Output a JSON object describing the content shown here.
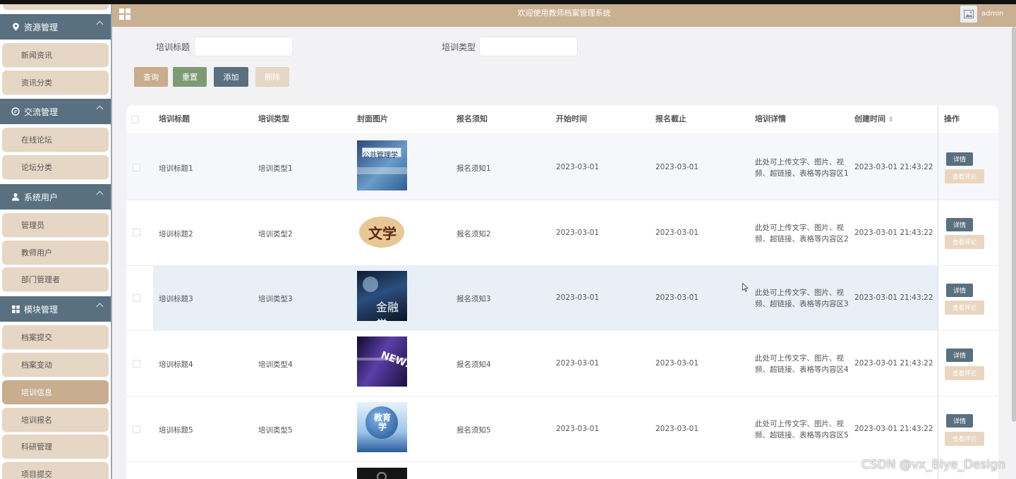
{
  "header": {
    "title": "欢迎使用教师档案管理系统",
    "username": "admin"
  },
  "sidebar": {
    "groups": [
      {
        "label": "资源管理",
        "icon": "location-pin-icon",
        "items": [
          "新闻资讯",
          "资讯分类"
        ]
      },
      {
        "label": "交流管理",
        "icon": "chat-icon",
        "items": [
          "在线论坛",
          "论坛分类"
        ]
      },
      {
        "label": "系统用户",
        "icon": "user-icon",
        "items": [
          "管理员",
          "教师用户",
          "部门管理者"
        ]
      },
      {
        "label": "模块管理",
        "icon": "grid-icon",
        "items": [
          "档案提交",
          "档案变动",
          "培训信息",
          "培训报名",
          "科研管理",
          "项目提交"
        ]
      }
    ],
    "active_item": "培训信息"
  },
  "search": {
    "title_label": "培训标题",
    "type_label": "培训类型",
    "title_value": "",
    "type_value": ""
  },
  "buttons": {
    "query": "查询",
    "reset": "重置",
    "add": "添加",
    "delete": "删除"
  },
  "colors": {
    "brand": "#c9b091",
    "nav_dark": "#58707f",
    "reset_green": "#7e9a74",
    "menu_bg": "#e6d6c4"
  },
  "table": {
    "columns": [
      "培训标题",
      "培训类型",
      "封面图片",
      "报名须知",
      "开始时间",
      "报名截止",
      "培训详情",
      "创建时间",
      "操作"
    ],
    "rows": [
      {
        "title": "培训标题1",
        "type": "培训类型1",
        "cover": "公共管理学",
        "notice": "报名须知1",
        "start": "2023-03-01",
        "deadline": "2023-03-01",
        "detail_l1": "此处可上传文字、图片、视",
        "detail_l2": "频、超链接、表格等内容区1",
        "created": "2023-03-01 21:43:22"
      },
      {
        "title": "培训标题2",
        "type": "培训类型2",
        "cover": "文学",
        "notice": "报名须知2",
        "start": "2023-03-01",
        "deadline": "2023-03-01",
        "detail_l1": "此处可上传文字、图片、视",
        "detail_l2": "频、超链接、表格等内容区2",
        "created": "2023-03-01 21:43:22"
      },
      {
        "title": "培训标题3",
        "type": "培训类型3",
        "cover": "金融学",
        "notice": "报名须知3",
        "start": "2023-03-01",
        "deadline": "2023-03-01",
        "detail_l1": "此处可上传文字、图片、视",
        "detail_l2": "频、超链接、表格等内容区3",
        "created": "2023-03-01 21:43:22"
      },
      {
        "title": "培训标题4",
        "type": "培训类型4",
        "cover": "NEWS",
        "notice": "报名须知4",
        "start": "2023-03-01",
        "deadline": "2023-03-01",
        "detail_l1": "此处可上传文字、图片、视",
        "detail_l2": "频、超链接、表格等内容区4",
        "created": "2023-03-01 21:43:22"
      },
      {
        "title": "培训标题5",
        "type": "培训类型5",
        "cover": "教育学",
        "notice": "报名须知5",
        "start": "2023-03-01",
        "deadline": "2023-03-01",
        "detail_l1": "此处可上传文字、图片、视",
        "detail_l2": "频、超链接、表格等内容区5",
        "created": "2023-03-01 21:43:22"
      }
    ],
    "actions": {
      "detail": "详情",
      "review": "查看评论"
    }
  },
  "watermark": "CSDN @vx_Biye_Design"
}
